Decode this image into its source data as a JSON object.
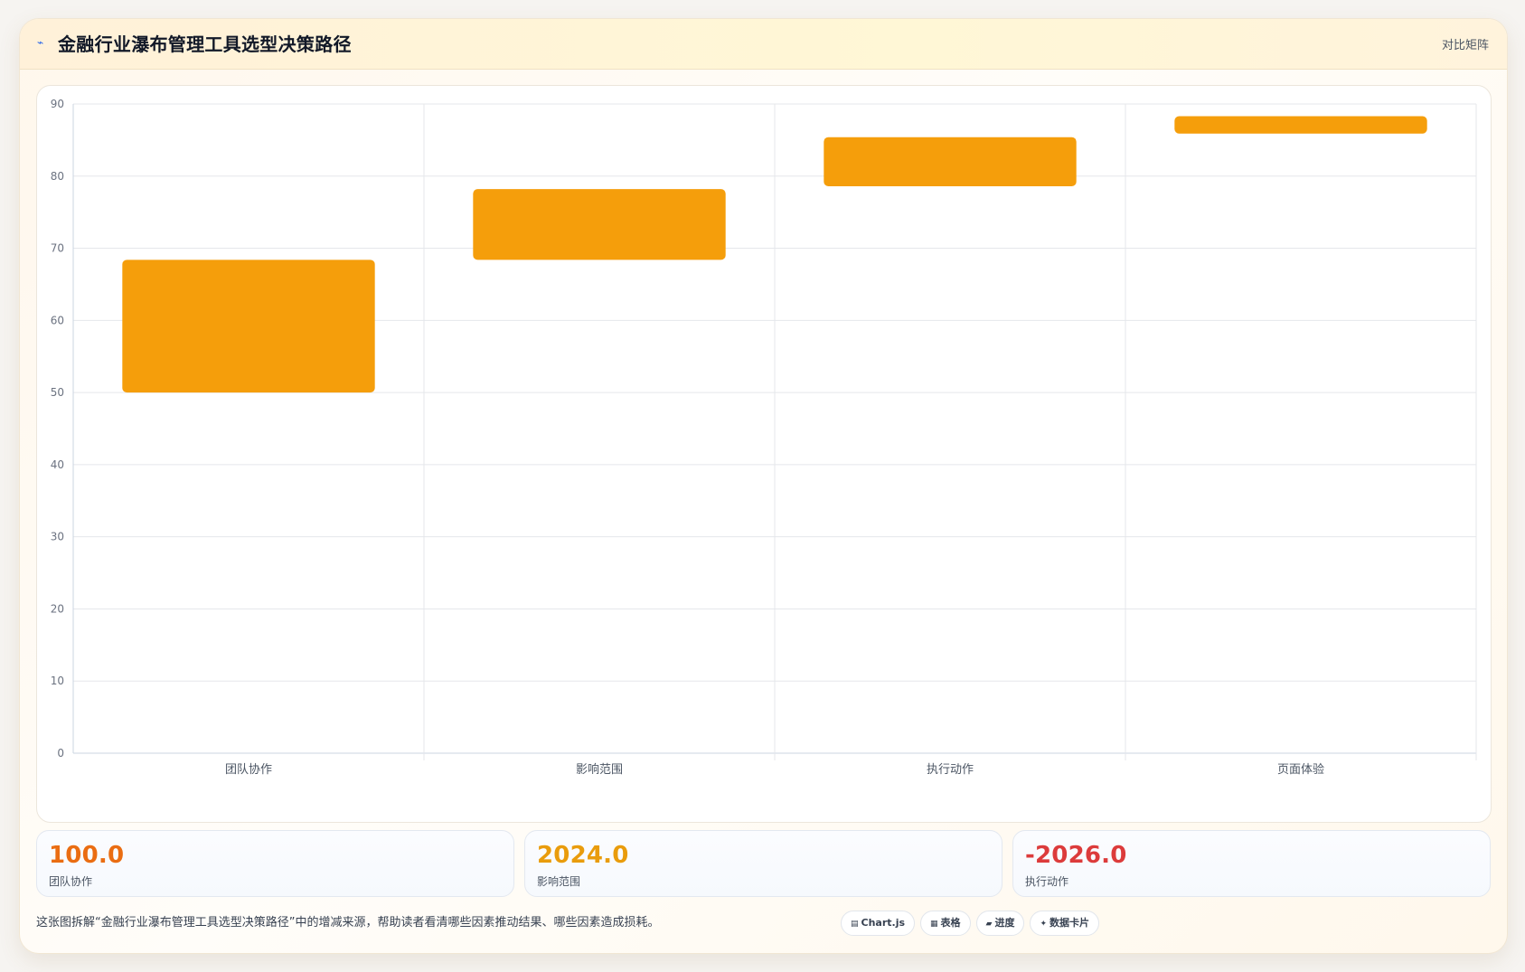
{
  "header": {
    "icon": "line-chart-icon",
    "icon_glyph": "⌁",
    "title": "金融行业瀑布管理工具选型决策路径",
    "action": "对比矩阵"
  },
  "colors": {
    "bar": "#f59e0b",
    "kpi_1": "#ea6d12",
    "kpi_2": "#e99c0c",
    "kpi_3": "#dc3b3b",
    "grid": "#e5e7eb",
    "axis_text": "#6b7280"
  },
  "chart_data": {
    "type": "bar",
    "subtype": "floating-waterfall",
    "categories": [
      "团队协作",
      "影响范围",
      "执行动作",
      "页面体验"
    ],
    "series": [
      {
        "ranges": [
          [
            50,
            68.4
          ],
          [
            68.4,
            78.2
          ],
          [
            78.6,
            85.4
          ],
          [
            85.9,
            88.3
          ]
        ]
      }
    ],
    "ylim": [
      0,
      90
    ],
    "yticks": [
      0,
      10,
      20,
      30,
      40,
      50,
      60,
      70,
      80,
      90
    ],
    "grid": true,
    "legend": "none",
    "title": "",
    "xlabel": "",
    "ylabel": ""
  },
  "kpis": [
    {
      "value": "100.0",
      "label": "团队协作"
    },
    {
      "value": "2024.0",
      "label": "影响范围"
    },
    {
      "value": "-2026.0",
      "label": "执行动作"
    }
  ],
  "footer": {
    "note": "这张图拆解“金融行业瀑布管理工具选型决策路径”中的增减来源，帮助读者看清哪些因素推动结果、哪些因素造成损耗。",
    "chips": [
      {
        "icon": "chart-icon",
        "glyph": "▤",
        "label": "Chart.js"
      },
      {
        "icon": "table-icon",
        "glyph": "▦",
        "label": "表格"
      },
      {
        "icon": "progress-icon",
        "glyph": "▰",
        "label": "进度"
      },
      {
        "icon": "sparkle-icon",
        "glyph": "✦",
        "label": "数据卡片"
      }
    ]
  }
}
